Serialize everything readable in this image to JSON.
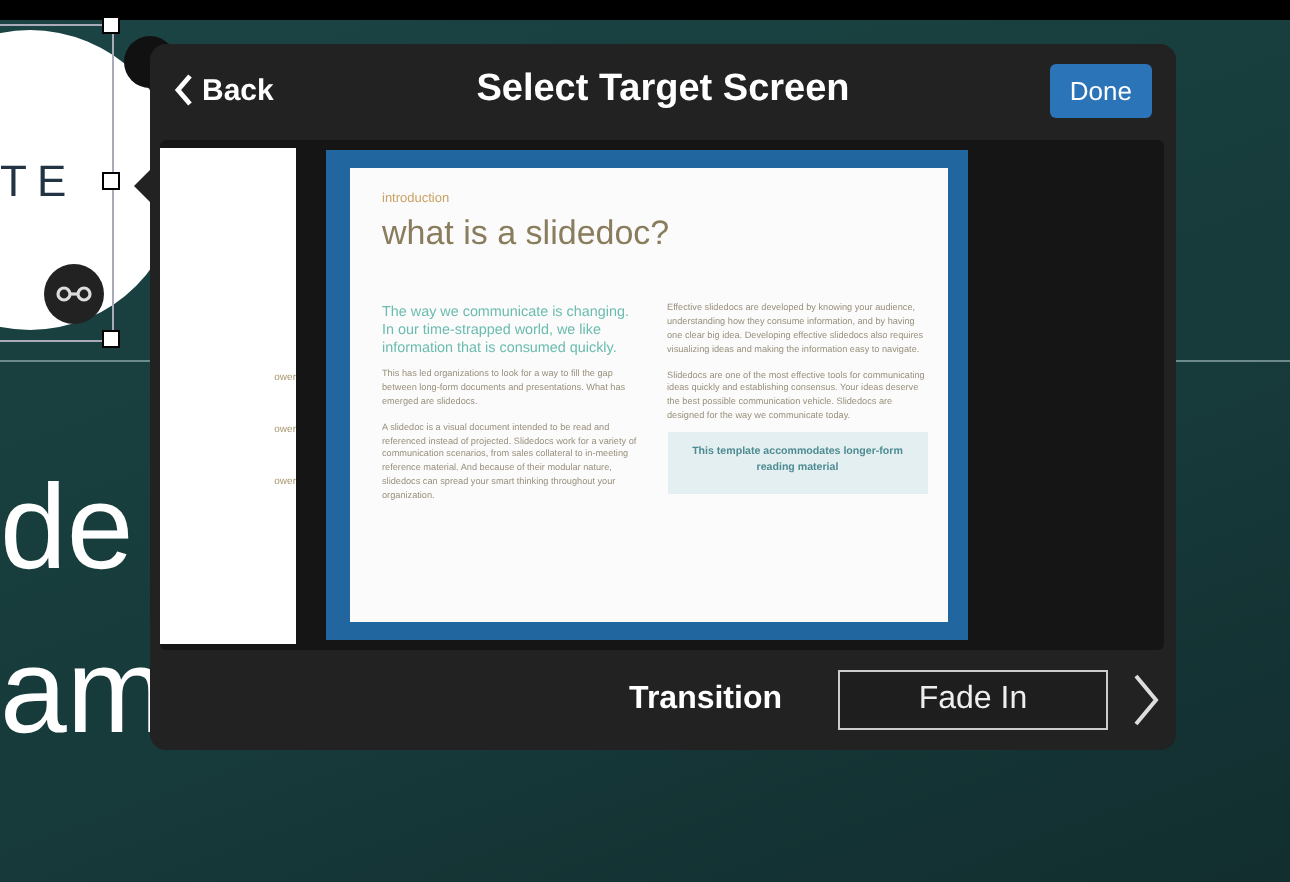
{
  "background": {
    "badge_text": "TE",
    "title_lines": [
      "de",
      "am"
    ]
  },
  "popover": {
    "back": "Back",
    "title": "Select Target Screen",
    "done": "Done"
  },
  "slides": [
    {
      "kind": "partial",
      "selected": false,
      "texts": [
        "ower",
        "ower",
        "ower"
      ]
    },
    {
      "kind": "full",
      "selected": true,
      "section": "introduction",
      "heading": "what is a slidedoc?",
      "lead": "The way we communicate is changing. In our time-strapped world, we like information that is consumed quickly.",
      "left_paragraphs": [
        "This has led organizations to look for a way to fill the gap between long-form documents and presentations. What has emerged are slidedocs.",
        "A slidedoc is a visual document intended to be read and referenced instead of projected. Slidedocs work for a variety of communication scenarios, from sales collateral to in-meeting reference material. And because of their modular nature, slidedocs can spread your smart thinking throughout your organization."
      ],
      "right_paragraphs": [
        "Effective slidedocs are developed by knowing your audience, understanding how they consume information, and by having one clear big idea. Developing effective slidedocs also requires visualizing ideas and making the information easy to navigate.",
        "Slidedocs are one of the most effective tools for communicating ideas quickly and establishing consensus. Your ideas deserve the best possible communication vehicle. Slidedocs are designed for the way we communicate today."
      ],
      "callout": "This template accommodates longer-form reading material"
    }
  ],
  "footer": {
    "label": "Transition",
    "value": "Fade In"
  }
}
